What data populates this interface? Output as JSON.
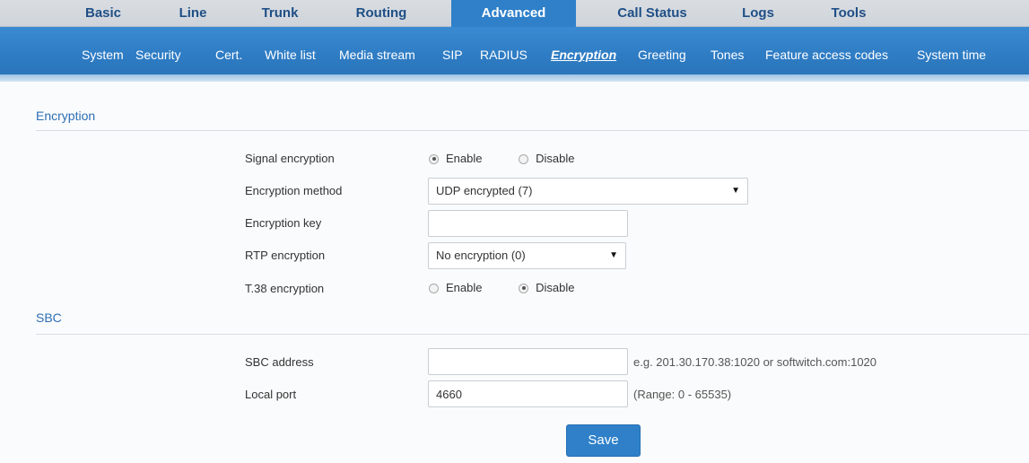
{
  "top_tabs": [
    {
      "label": "Basic"
    },
    {
      "label": "Line"
    },
    {
      "label": "Trunk"
    },
    {
      "label": "Routing"
    },
    {
      "label": "Advanced",
      "active": true
    },
    {
      "label": "Call Status"
    },
    {
      "label": "Logs"
    },
    {
      "label": "Tools"
    }
  ],
  "sub_tabs": [
    {
      "label": "System"
    },
    {
      "label": "Security"
    },
    {
      "label": "Cert."
    },
    {
      "label": "White list"
    },
    {
      "label": "Media stream"
    },
    {
      "label": "SIP"
    },
    {
      "label": "RADIUS"
    },
    {
      "label": "Encryption",
      "active": true
    },
    {
      "label": "Greeting"
    },
    {
      "label": "Tones"
    },
    {
      "label": "Feature access codes"
    },
    {
      "label": "System time"
    }
  ],
  "encryption": {
    "title": "Encryption",
    "signal_encryption": {
      "label": "Signal encryption",
      "enable": "Enable",
      "disable": "Disable",
      "selected": "Enable"
    },
    "encryption_method": {
      "label": "Encryption method",
      "value": "UDP encrypted (7)"
    },
    "encryption_key": {
      "label": "Encryption key",
      "value": ""
    },
    "rtp_encryption": {
      "label": "RTP encryption",
      "value": "No encryption (0)"
    },
    "t38_encryption": {
      "label": "T.38 encryption",
      "enable": "Enable",
      "disable": "Disable",
      "selected": "Disable"
    }
  },
  "sbc": {
    "title": "SBC",
    "sbc_address": {
      "label": "SBC address",
      "value": "",
      "hint": "e.g. 201.30.170.38:1020 or softwitch.com:1020"
    },
    "local_port": {
      "label": "Local port",
      "value": "4660",
      "hint": "(Range: 0 - 65535)"
    }
  },
  "save_label": "Save",
  "colors": {
    "accent": "#2f80c9",
    "nav_text": "#1f4f86",
    "section_title": "#2d6fb5"
  }
}
